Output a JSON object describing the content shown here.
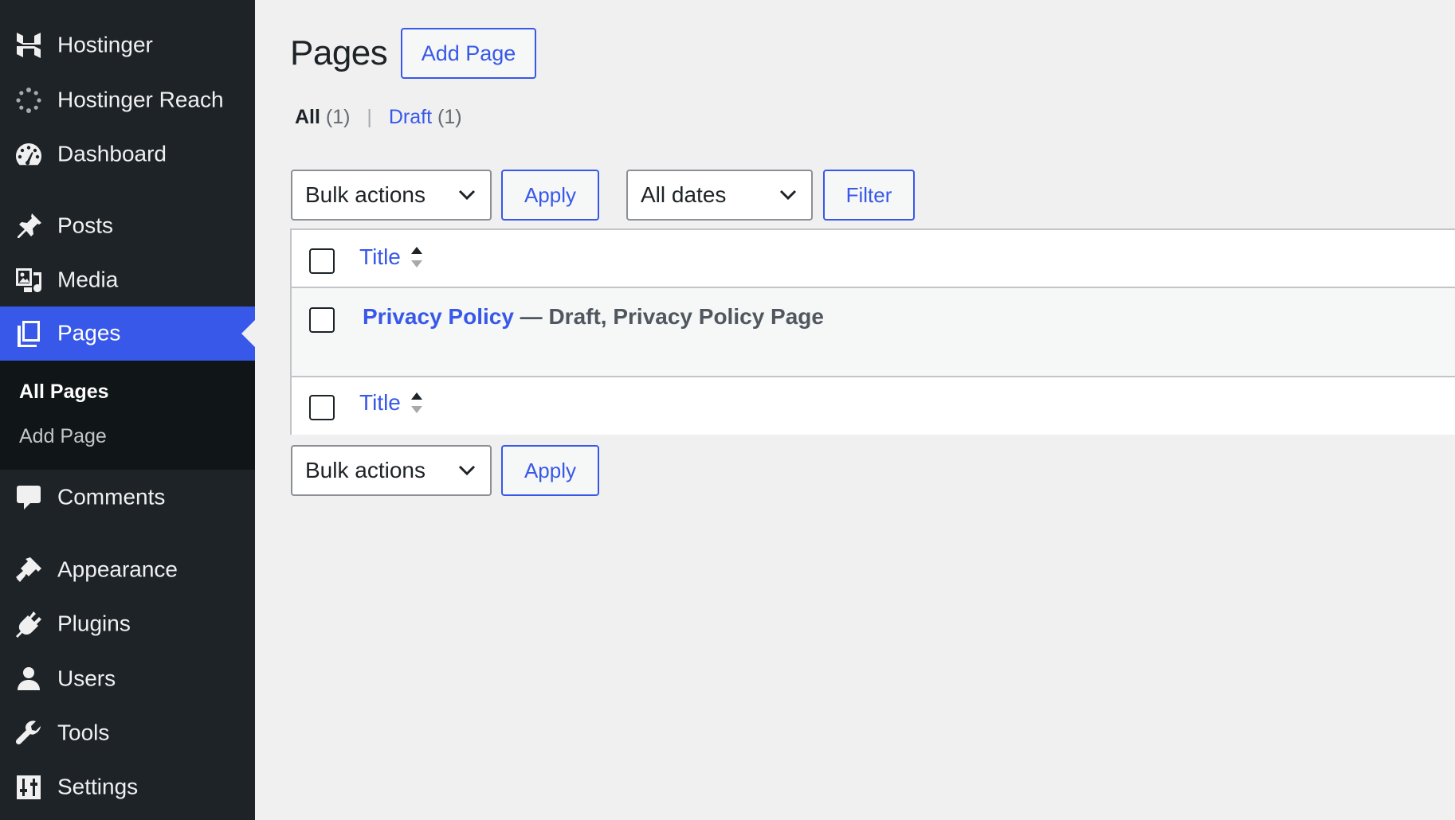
{
  "sidebar": {
    "items": [
      {
        "label": "Hostinger",
        "icon": "hostinger-logo-icon"
      },
      {
        "label": "Hostinger Reach",
        "icon": "reach-spinner-icon"
      },
      {
        "label": "Dashboard",
        "icon": "dashboard-gauge-icon"
      },
      {
        "label": "Posts",
        "icon": "pushpin-icon"
      },
      {
        "label": "Media",
        "icon": "media-icon"
      },
      {
        "label": "Pages",
        "icon": "pages-icon",
        "current": true
      },
      {
        "label": "Comments",
        "icon": "comment-bubble-icon"
      },
      {
        "label": "Appearance",
        "icon": "paintbrush-icon"
      },
      {
        "label": "Plugins",
        "icon": "plug-icon"
      },
      {
        "label": "Users",
        "icon": "user-icon"
      },
      {
        "label": "Tools",
        "icon": "wrench-icon"
      },
      {
        "label": "Settings",
        "icon": "settings-sliders-icon"
      }
    ],
    "submenu": [
      {
        "label": "All Pages",
        "current": true
      },
      {
        "label": "Add Page"
      }
    ]
  },
  "main": {
    "heading": "Pages",
    "add_page_label": "Add Page",
    "views": {
      "all_label": "All",
      "all_count": "(1)",
      "separator": "|",
      "draft_label": "Draft",
      "draft_count": "(1)"
    },
    "bulk_actions_label": "Bulk actions",
    "apply_label": "Apply",
    "dates_label": "All dates",
    "filter_label": "Filter",
    "table": {
      "title_header": "Title",
      "rows": [
        {
          "title": "Privacy Policy",
          "state": " — Draft, Privacy Policy Page"
        }
      ]
    }
  },
  "colors": {
    "sidebar_bg": "#1d2327",
    "submenu_bg": "#101517",
    "accent": "#3858e9",
    "page_bg": "#f0f0f1"
  }
}
